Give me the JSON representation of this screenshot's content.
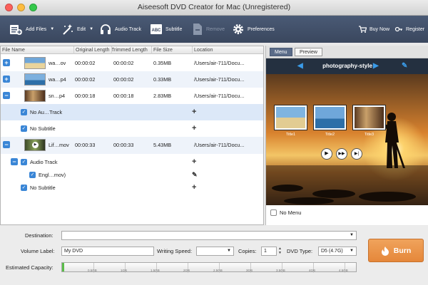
{
  "window": {
    "title": "Aiseesoft DVD Creator for Mac (Unregistered)"
  },
  "toolbar": {
    "add_files": "Add Files",
    "edit": "Edit",
    "audio_track": "Audio Track",
    "subtitle": "Subtitle",
    "remove": "Remove",
    "preferences": "Preferences",
    "buy_now": "Buy Now",
    "register": "Register"
  },
  "table": {
    "columns": [
      "File Name",
      "Original Length",
      "Trimmed Length",
      "File Size",
      "Location"
    ],
    "rows": [
      {
        "name": "wa…ov",
        "original": "00:00:02",
        "trimmed": "00:00:02",
        "size": "0.35MB",
        "location": "/Users/air-711/Docu..."
      },
      {
        "name": "wa…p4",
        "original": "00:00:02",
        "trimmed": "00:00:02",
        "size": "0.33MB",
        "location": "/Users/air-711/Docu..."
      },
      {
        "name": "sn…p4",
        "original": "00:00:18",
        "trimmed": "00:00:18",
        "size": "2.83MB",
        "location": "/Users/air-711/Docu..."
      },
      {
        "name": "Lif…mov",
        "original": "00:00:33",
        "trimmed": "00:00:33",
        "size": "5.43MB",
        "location": "/Users/air-711/Docu..."
      }
    ],
    "sub3": {
      "audio": "No Au…Track",
      "subtitle": "No Subtitle"
    },
    "sub4": {
      "audio_header": "Audio Track",
      "audio_item": "Engl…mov)",
      "subtitle": "No Subtitle"
    }
  },
  "preview": {
    "tabs": [
      "Menu",
      "Preview"
    ],
    "template": "photography-style",
    "thumb_titles": [
      "Title1",
      "Title2",
      "Title3"
    ],
    "no_menu": "No Menu"
  },
  "bottom": {
    "destination_label": "Destination:",
    "volume_label": "Volume Label:",
    "volume_value": "My DVD",
    "writing_speed_label": "Writing Speed:",
    "copies_label": "Copies:",
    "copies_value": "1",
    "dvd_type_label": "DVD Type:",
    "dvd_type_value": "D5 (4.7G)",
    "capacity_label": "Estimated Capacity:",
    "capacity_ticks": [
      "0.5GB",
      "1GB",
      "1.5GB",
      "2GB",
      "2.5GB",
      "3GB",
      "3.5GB",
      "4GB",
      "4.5GB"
    ],
    "burn": "Burn"
  },
  "colors": {
    "accent": "#3a86d6",
    "toolbar": "#3f4c64",
    "burn": "#e98f45"
  }
}
